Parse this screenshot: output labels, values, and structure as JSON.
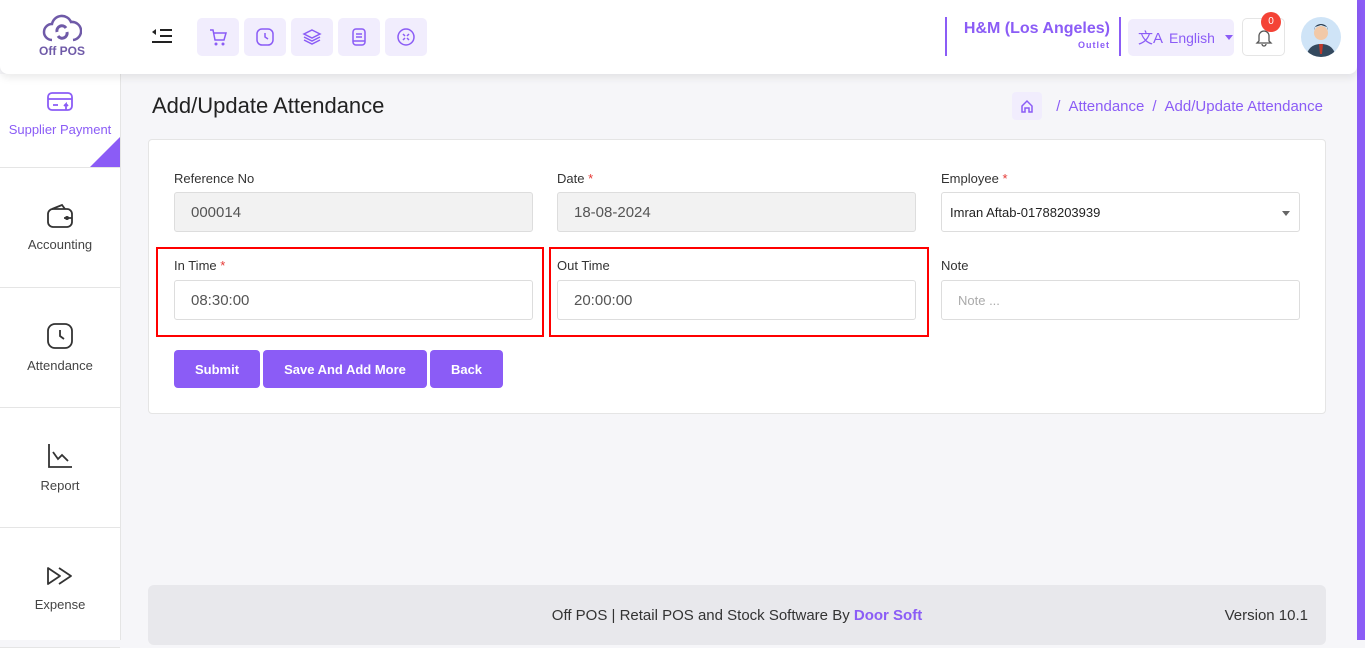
{
  "app": {
    "logo_text": "Off POS"
  },
  "header": {
    "outlet_name": "H&M (Los Angeles)",
    "outlet_sub": "Outlet",
    "language": "English",
    "notification_count": "0"
  },
  "sidebar": {
    "items": [
      {
        "label": "Supplier Payment"
      },
      {
        "label": "Accounting"
      },
      {
        "label": "Attendance"
      },
      {
        "label": "Report"
      },
      {
        "label": "Expense"
      }
    ]
  },
  "page": {
    "title": "Add/Update Attendance",
    "breadcrumb": [
      "Attendance",
      "Add/Update Attendance"
    ]
  },
  "form": {
    "reference_label": "Reference No",
    "reference_value": "000014",
    "date_label": "Date",
    "date_value": "18-08-2024",
    "employee_label": "Employee",
    "employee_value": "Imran Aftab-01788203939",
    "in_label": "In Time",
    "in_value": "08:30:00",
    "out_label": "Out Time",
    "out_value": "20:00:00",
    "note_label": "Note",
    "note_placeholder": "Note ...",
    "required": "*",
    "submit": "Submit",
    "save_more": "Save And Add More",
    "back": "Back"
  },
  "footer": {
    "text": "Off POS | Retail POS and Stock Software By",
    "brand": "Door Soft",
    "version": "Version 10.1"
  }
}
